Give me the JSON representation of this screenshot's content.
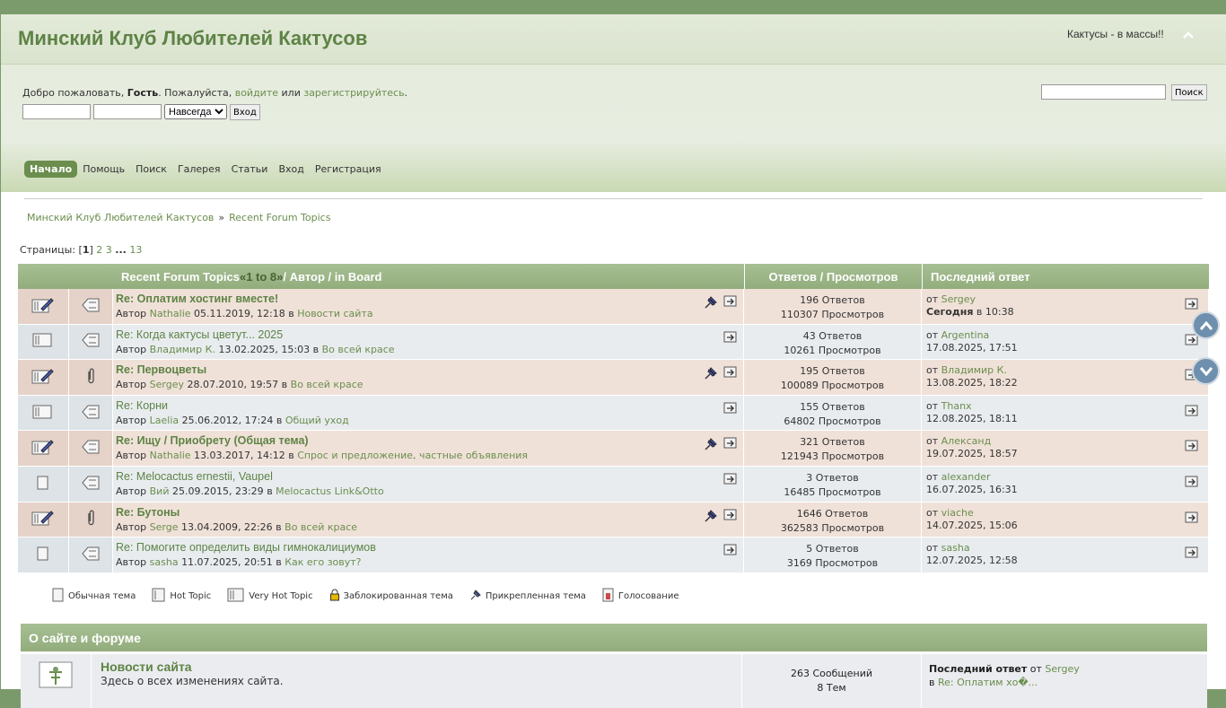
{
  "header": {
    "forum_title": "Минский Клуб Любителей Кактусов",
    "slogan": "Кактусы - в массы!!",
    "collapse_glyph": "^"
  },
  "userbar": {
    "welcome_prefix": "Добро пожаловать, ",
    "guest": "Гость",
    "please": ". Пожалуйста, ",
    "login_link": "войдите",
    "or": " или ",
    "register_link": "зарегистрируйтесь",
    "dot": ".",
    "duration_selected": "Навсегда",
    "login_button": "Вход",
    "search_button": "Поиск"
  },
  "menu": {
    "items": [
      {
        "label": "Начало",
        "active": true
      },
      {
        "label": "Помощь",
        "active": false
      },
      {
        "label": "Поиск",
        "active": false
      },
      {
        "label": "Галерея",
        "active": false
      },
      {
        "label": "Статьи",
        "active": false
      },
      {
        "label": "Вход",
        "active": false
      },
      {
        "label": "Регистрация",
        "active": false
      }
    ]
  },
  "breadcrumb": {
    "home": "Минский Клуб Любителей Кактусов",
    "sep": "»",
    "current": "Recent Forum Topics"
  },
  "pagination": {
    "label": "Страницы: [",
    "current": "1",
    "close": "] ",
    "p2": "2",
    "p3": "3",
    "ellipsis": "...",
    "last": "13"
  },
  "table_head": {
    "title": "Recent Forum Topics",
    "range_open": " « ",
    "range": "1 to 8",
    "range_close": " » ",
    "rest": "/ Автор / in Board",
    "stats": "Ответов / Просмотров",
    "last": "Последний ответ"
  },
  "topics": [
    {
      "title": "Re: Оплатим хостинг вместе!",
      "bold": true,
      "author_label": "Автор",
      "author": "Nathalie",
      "date": "05.11.2019, 12:18",
      "in": "в",
      "board": "Новости сайта",
      "replies": "196 Ответов",
      "views": "110307 Просмотров",
      "by": "от",
      "last_user": "Sergey",
      "last_date_bold": "Сегодня",
      "last_date": " в 10:38",
      "sticky": true,
      "attach": false
    },
    {
      "title": "Re: Когда кактусы цветут... 2025",
      "bold": false,
      "author_label": "Автор",
      "author": "Владимир К.",
      "date": "13.02.2025, 15:03",
      "in": "в",
      "board": "Во всей красе",
      "replies": "43 Ответов",
      "views": "10261 Просмотров",
      "by": "от",
      "last_user": "Argentina",
      "last_date_bold": "",
      "last_date": "17.08.2025, 17:51",
      "sticky": false,
      "attach": false
    },
    {
      "title": "Re: Первоцветы",
      "bold": true,
      "author_label": "Автор",
      "author": "Sergey",
      "date": "28.07.2010, 19:57",
      "in": "в",
      "board": "Во всей красе",
      "replies": "195 Ответов",
      "views": "100089 Просмотров",
      "by": "от",
      "last_user": "Владимир К.",
      "last_date_bold": "",
      "last_date": "13.08.2025, 18:22",
      "sticky": true,
      "attach": true
    },
    {
      "title": "Re: Корни",
      "bold": false,
      "author_label": "Автор",
      "author": "Laelia",
      "date": "25.06.2012, 17:24",
      "in": "в",
      "board": "Общий уход",
      "replies": "155 Ответов",
      "views": "64802 Просмотров",
      "by": "от",
      "last_user": "Thanx",
      "last_date_bold": "",
      "last_date": "12.08.2025, 18:11",
      "sticky": false,
      "attach": false
    },
    {
      "title": "Re: Ищу / Приобрету (Общая тема)",
      "bold": true,
      "author_label": "Автор",
      "author": "Nathalie",
      "date": "13.03.2017, 14:12",
      "in": "в",
      "board": "Спрос и предложение, частные объявления",
      "replies": "321 Ответов",
      "views": "121943 Просмотров",
      "by": "от",
      "last_user": "Александ",
      "last_date_bold": "",
      "last_date": "19.07.2025, 18:57",
      "sticky": true,
      "attach": false
    },
    {
      "title": "Re: Melocactus ernestii, Vaupel",
      "bold": false,
      "author_label": "Автор",
      "author": "Вий",
      "date": "25.09.2015, 23:29",
      "in": "в",
      "board": "Melocactus Link&Otto",
      "replies": "3 Ответов",
      "views": "16485 Просмотров",
      "by": "от",
      "last_user": "alexander",
      "last_date_bold": "",
      "last_date": "16.07.2025, 16:31",
      "sticky": false,
      "attach": false
    },
    {
      "title": "Re: Бутоны",
      "bold": true,
      "author_label": "Автор",
      "author": "Serge",
      "date": "13.04.2009, 22:26",
      "in": "в",
      "board": "Во всей красе",
      "replies": "1646 Ответов",
      "views": "362583 Просмотров",
      "by": "от",
      "last_user": "viache",
      "last_date_bold": "",
      "last_date": "14.07.2025, 15:06",
      "sticky": true,
      "attach": true
    },
    {
      "title": "Re: Помогите определить виды гимнокалициумов",
      "bold": false,
      "author_label": "Автор",
      "author": "sasha",
      "date": "11.07.2025, 20:51",
      "in": "в",
      "board": "Как его зовут?",
      "replies": "5 Ответов",
      "views": "3169 Просмотров",
      "by": "от",
      "last_user": "sasha",
      "last_date_bold": "",
      "last_date": "12.07.2025, 12:58",
      "sticky": false,
      "attach": false
    }
  ],
  "legend": {
    "normal": "Обычная тема",
    "hot": "Hot Topic",
    "veryhot": "Very Hot Topic",
    "locked": "Заблокированная тема",
    "sticky": "Прикрепленная тема",
    "poll": "Голосование"
  },
  "about": {
    "title": "О сайте и форуме",
    "board_name": "Новости сайта",
    "board_desc": "Здесь о всех изменениях сайта.",
    "posts": "263 Сообщений",
    "topics": "8 Тем",
    "last_label": "Последний ответ",
    "by": " от ",
    "last_user": "Sergey",
    "in": "в ",
    "last_topic": "Re: Оплатим хо�..."
  },
  "colors": {
    "accent": "#6b8e4e",
    "header_bg": "#92ad7c",
    "row_odd": "#f0e1d8",
    "row_even": "#e8ecef"
  }
}
